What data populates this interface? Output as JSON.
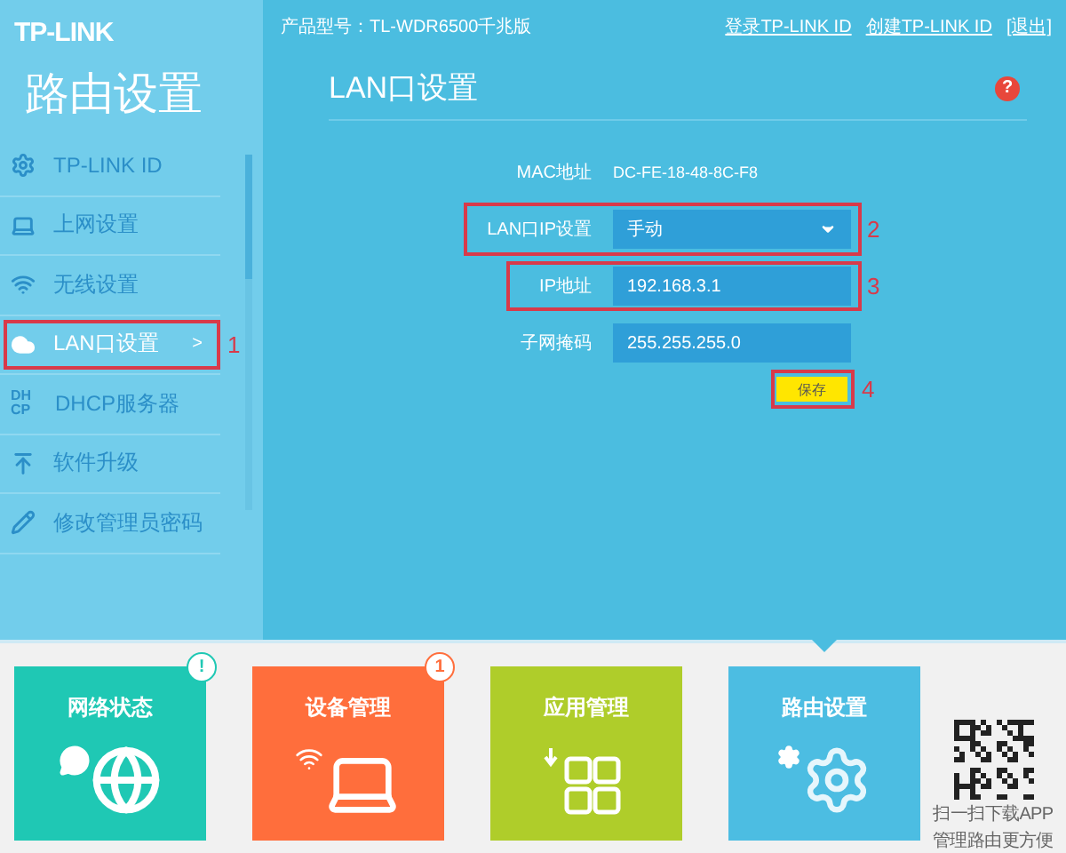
{
  "header": {
    "logo": "TP-LINK",
    "model": "产品型号：TL-WDR6500千兆版",
    "links": [
      "登录TP-LINK ID",
      "创建TP-LINK ID",
      "[退出]"
    ]
  },
  "sidebar": {
    "title": "路由设置",
    "items": [
      {
        "kind": "gear",
        "label": "TP-LINK ID",
        "selected": false
      },
      {
        "kind": "laptop",
        "label": "上网设置",
        "selected": false
      },
      {
        "kind": "wifi",
        "label": "无线设置",
        "selected": false
      },
      {
        "kind": "cloud",
        "label": "LAN口设置",
        "selected": true,
        "arrow": ">",
        "callout": "1"
      },
      {
        "kind": "text",
        "icon_text": [
          "DH",
          "CP"
        ],
        "label": "DHCP服务器",
        "selected": false
      },
      {
        "kind": "upload",
        "label": "软件升级",
        "selected": false
      },
      {
        "kind": "pencil",
        "label": "修改管理员密码",
        "selected": false
      }
    ]
  },
  "panel": {
    "title": "LAN口设置",
    "help": "?",
    "rows": [
      {
        "kind": "text",
        "label": "MAC地址",
        "value": "DC-FE-18-48-8C-F8"
      },
      {
        "kind": "select",
        "label": "LAN口IP设置",
        "value": "手动",
        "callout": "2"
      },
      {
        "kind": "input",
        "label": "IP地址",
        "value": "192.168.3.1",
        "callout": "3"
      },
      {
        "kind": "input",
        "label": "子网掩码",
        "value": "255.255.255.0"
      }
    ],
    "save": {
      "label": "保存",
      "callout": "4"
    }
  },
  "tiles": [
    {
      "kind": "globe",
      "label": "网络状态",
      "color": "#1fc8b4",
      "badge": "!",
      "selected": false
    },
    {
      "kind": "laptop",
      "label": "设备管理",
      "color": "#ff6e3c",
      "badge": "1",
      "selected": false
    },
    {
      "kind": "apps",
      "label": "应用管理",
      "color": "#afcd2a",
      "selected": false
    },
    {
      "kind": "gear",
      "label": "路由设置",
      "color": "#4cbde2",
      "selected": true
    }
  ],
  "app_promo": {
    "lines": [
      "扫一扫下载APP",
      "管理路由更方便"
    ]
  }
}
